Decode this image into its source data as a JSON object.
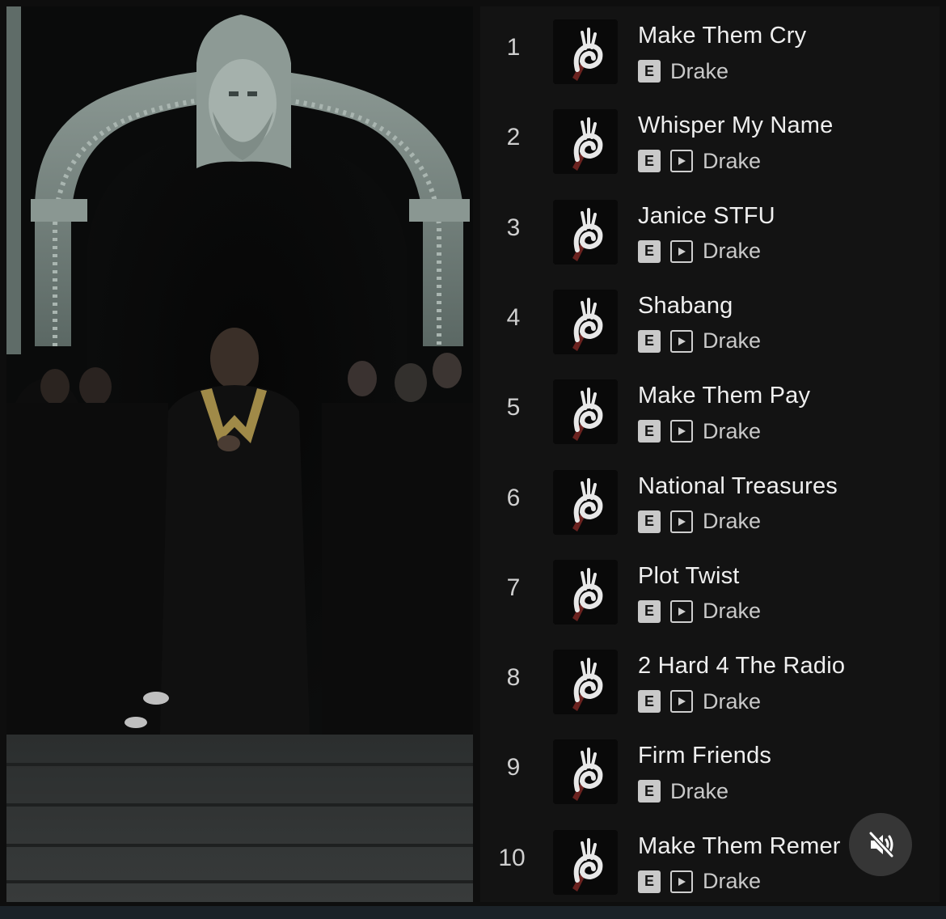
{
  "tracks": [
    {
      "number": "1",
      "title": "Make Them Cry",
      "artist": "Drake",
      "explicit": true,
      "has_video": false
    },
    {
      "number": "2",
      "title": "Whisper My Name",
      "artist": "Drake",
      "explicit": true,
      "has_video": true
    },
    {
      "number": "3",
      "title": "Janice STFU",
      "artist": "Drake",
      "explicit": true,
      "has_video": true
    },
    {
      "number": "4",
      "title": "Shabang",
      "artist": "Drake",
      "explicit": true,
      "has_video": true
    },
    {
      "number": "5",
      "title": "Make Them Pay",
      "artist": "Drake",
      "explicit": true,
      "has_video": true
    },
    {
      "number": "6",
      "title": "National Treasures",
      "artist": "Drake",
      "explicit": true,
      "has_video": true
    },
    {
      "number": "7",
      "title": "Plot Twist",
      "artist": "Drake",
      "explicit": true,
      "has_video": true
    },
    {
      "number": "8",
      "title": "2 Hard 4 The Radio",
      "artist": "Drake",
      "explicit": true,
      "has_video": true
    },
    {
      "number": "9",
      "title": "Firm Friends",
      "artist": "Drake",
      "explicit": true,
      "has_video": false
    },
    {
      "number": "10",
      "title": "Make Them Remer",
      "artist": "Drake",
      "explicit": true,
      "has_video": true
    }
  ],
  "badges": {
    "explicit_label": "E"
  },
  "icons": {
    "explicit": "explicit-badge-icon",
    "video": "music-video-icon",
    "cover": "album-cover-hand-ok-icon",
    "mute": "speaker-muted-icon"
  },
  "colors": {
    "panel_background": "#131313",
    "title_text": "#efefef",
    "artist_text": "#c9c9c9",
    "badge_fill": "#c9c9c9"
  }
}
